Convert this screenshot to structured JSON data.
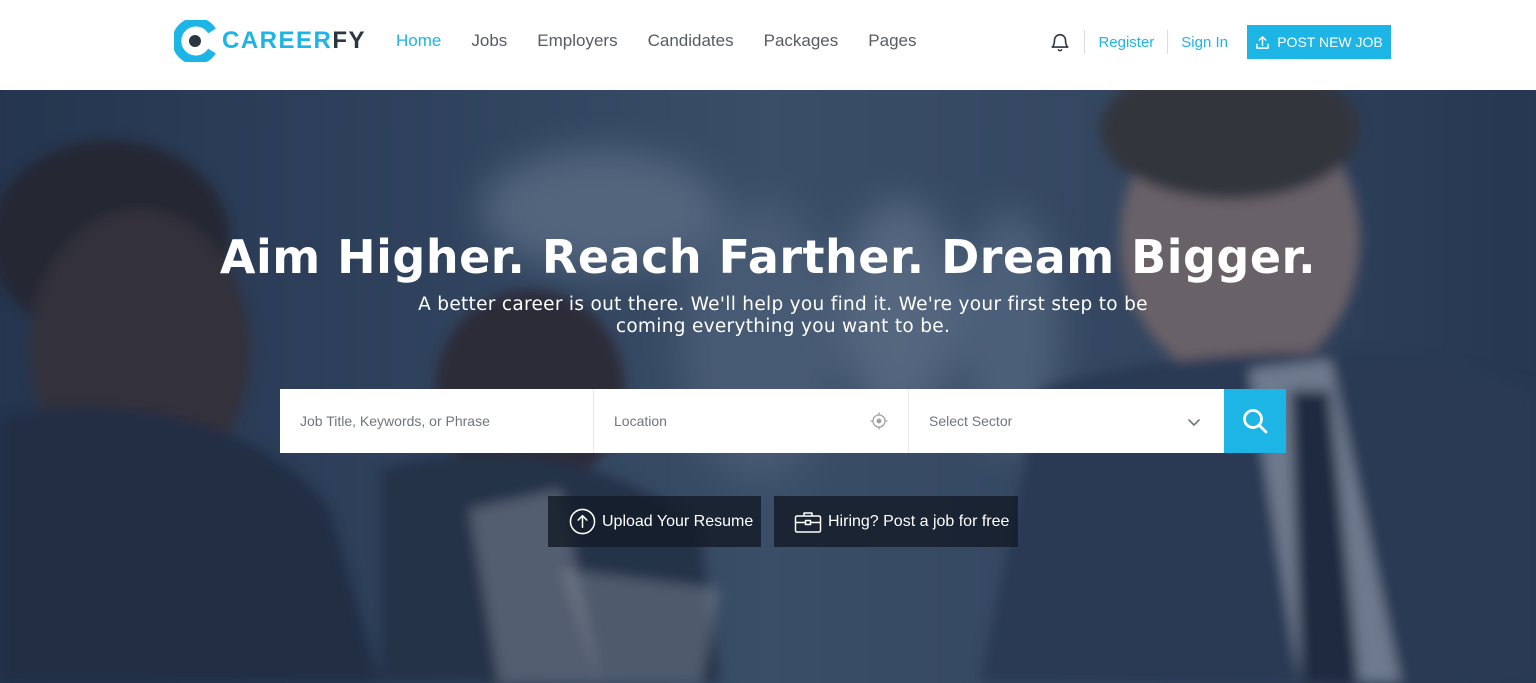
{
  "brand": {
    "part1": "CAREER",
    "part2": "FY",
    "accent": "#1cb5e6",
    "dark": "#2b3640"
  },
  "nav": {
    "items": [
      {
        "label": "Home",
        "active": true
      },
      {
        "label": "Jobs"
      },
      {
        "label": "Employers"
      },
      {
        "label": "Candidates"
      },
      {
        "label": "Packages"
      },
      {
        "label": "Pages"
      }
    ]
  },
  "header": {
    "notification_icon": "bell-icon",
    "register_label": "Register",
    "signin_label": "Sign In",
    "post_job_label": "POST NEW JOB",
    "post_job_icon": "upload-icon"
  },
  "hero": {
    "headline": "Aim Higher. Reach Farther. Dream Bigger.",
    "subline": "A better career is out there. We'll help you find it. We're your first step to be coming everything you want to be."
  },
  "search": {
    "keyword_placeholder": "Job Title, Keywords, or Phrase",
    "location_placeholder": "Location",
    "location_icon": "crosshair-icon",
    "sector_selected": "Select Sector",
    "sector_icon": "chevron-down-icon",
    "button_icon": "search-icon"
  },
  "actions": {
    "upload_label": "Upload Your Resume",
    "upload_icon": "arrow-up-circle-icon",
    "hiring_label": "Hiring? Post a job for free",
    "hiring_icon": "briefcase-icon"
  }
}
